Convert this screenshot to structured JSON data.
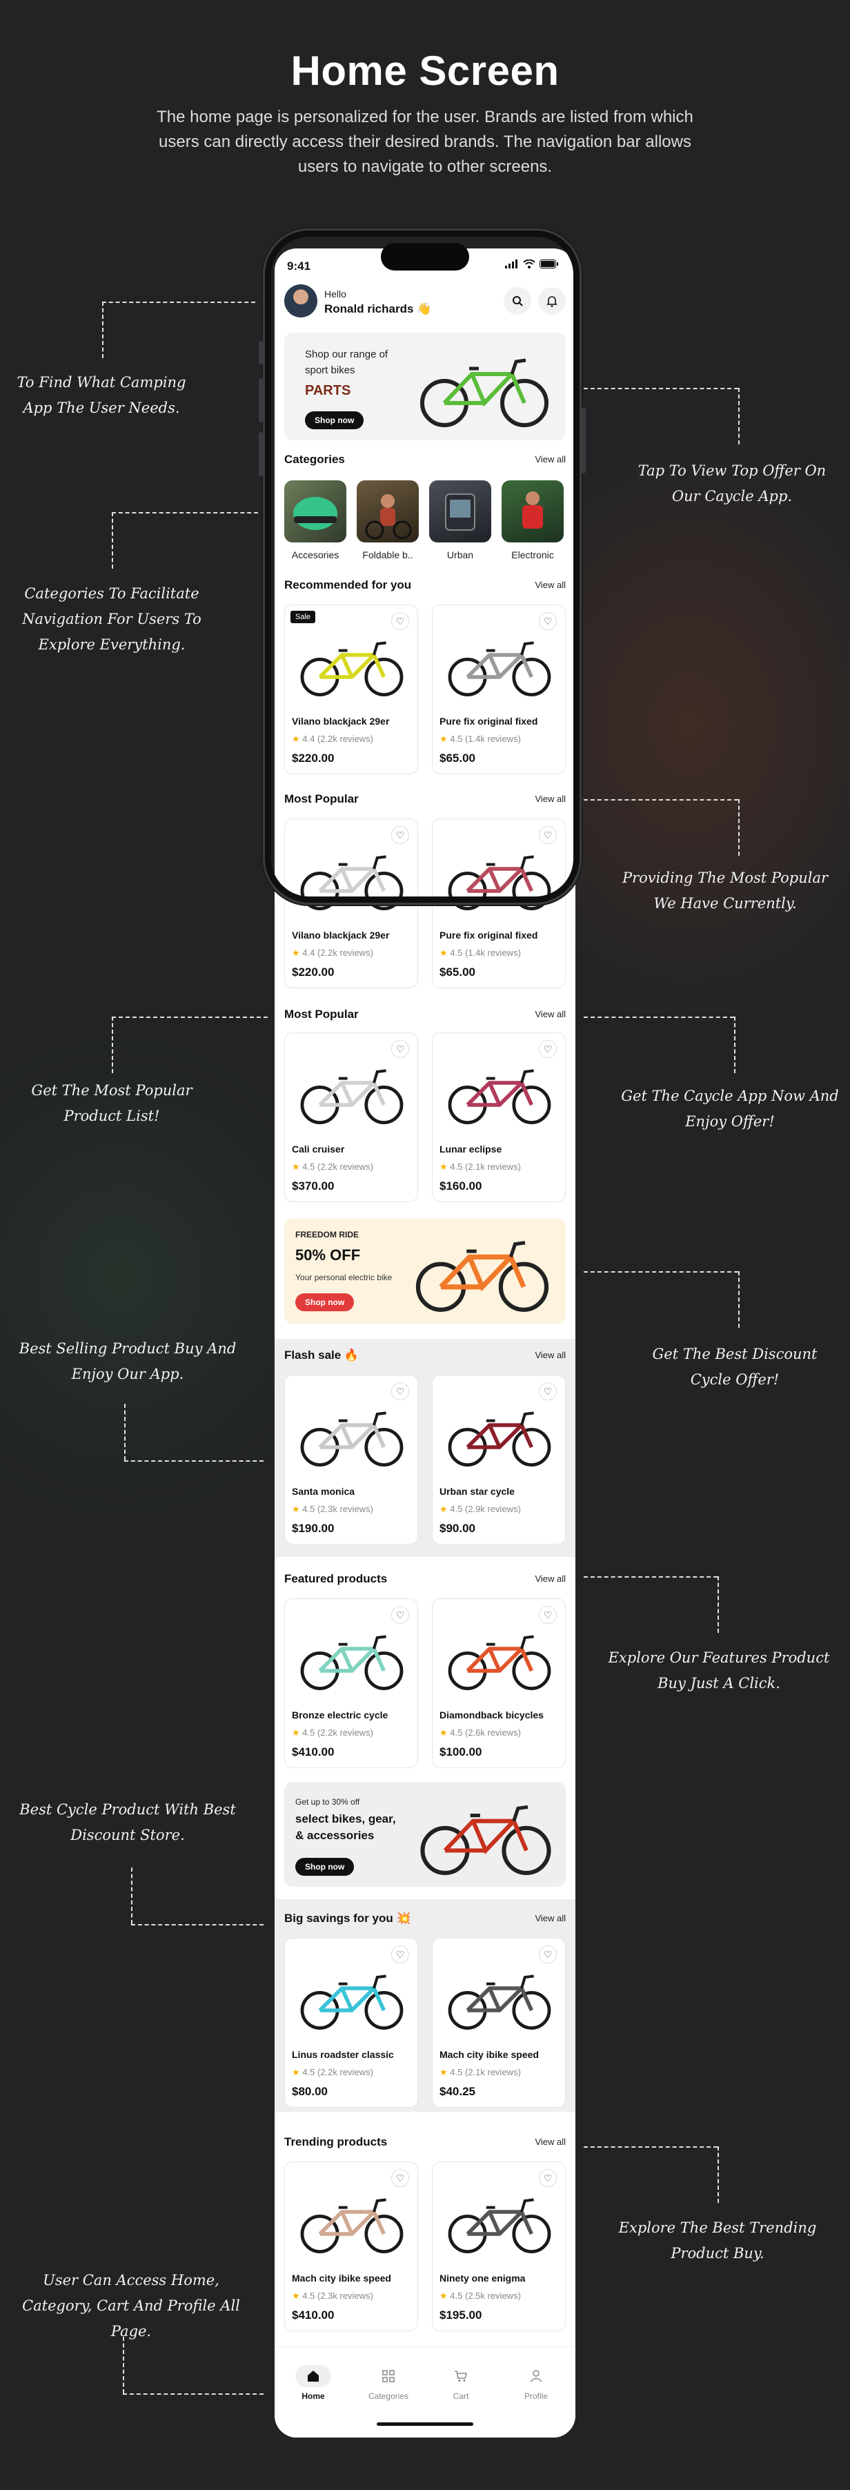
{
  "hero": {
    "title": "Home Screen",
    "description": "The home page is personalized for the user. Brands are listed from which users can directly access their desired brands. The navigation bar allows users to navigate to other screens."
  },
  "annotations": [
    "To Find What Camping App The User Needs.",
    "Tap To View Top Offer On Our Caycle App.",
    "Categories To Facilitate Navigation For Users To Explore Everything.",
    "Providing The Most Popular We Have Currently.",
    "Get The Most Popular Product List!",
    "Get The Caycle App Now And Enjoy Offer!",
    "Best Selling Product Buy And Enjoy Our App.",
    "Get The Best Discount Cycle Offer!",
    "Explore Our Features Product Buy Just A Click.",
    "Best Cycle Product With Best Discount Store.",
    "Explore The Best Trending Product Buy.",
    "User Can Access Home, Category, Cart And Profile All Page."
  ],
  "status_bar": {
    "time": "9:41"
  },
  "user": {
    "greeting": "Hello",
    "name": "Ronald richards 👋"
  },
  "promo1": {
    "text": "Shop our range of sport bikes",
    "subtitle": "PARTS",
    "button": "Shop now"
  },
  "view_all": "View all",
  "sections": {
    "categories": "Categories",
    "recommended": "Recommended for you",
    "most_popular": "Most Popular",
    "flash_sale": "Flash sale 🔥",
    "featured": "Featured products",
    "big_savings": "Big savings for you 💥",
    "trending": "Trending products"
  },
  "categories": [
    {
      "label": "Accesories"
    },
    {
      "label": "Foldable b.."
    },
    {
      "label": "Urban"
    },
    {
      "label": "Electronic"
    }
  ],
  "sale_badge": "Sale",
  "products": {
    "recommended": [
      {
        "name": "Vilano blackjack 29er",
        "rating": "4.4",
        "reviews": "(2.2k reviews)",
        "price": "$220.00",
        "color": "#d8d820"
      },
      {
        "name": "Pure fix original fixed",
        "rating": "4.5",
        "reviews": "(1.4k reviews)",
        "price": "$65.00",
        "color": "#9a9a9a"
      }
    ],
    "popular_a": [
      {
        "name": "Vilano blackjack 29er",
        "rating": "4.4",
        "reviews": "(2.2k reviews)",
        "price": "$220.00",
        "color": "#cfcfcf"
      },
      {
        "name": "Pure fix original fixed",
        "rating": "4.5",
        "reviews": "(1.4k reviews)",
        "price": "$65.00",
        "color": "#b84a5e"
      }
    ],
    "popular_b": [
      {
        "name": "Cali cruiser",
        "rating": "4.5",
        "reviews": "(2.2k reviews)",
        "price": "$370.00",
        "color": "#d0d0d0"
      },
      {
        "name": "Lunar eclipse",
        "rating": "4.5",
        "reviews": "(2.1k reviews)",
        "price": "$160.00",
        "color": "#b03a5a"
      }
    ],
    "flash_sale": [
      {
        "name": "Santa monica",
        "rating": "4.5",
        "reviews": "(2.3k reviews)",
        "price": "$190.00",
        "color": "#c9c9c9"
      },
      {
        "name": "Urban star cycle",
        "rating": "4.5",
        "reviews": "(2.9k reviews)",
        "price": "$90.00",
        "color": "#8a1f2a"
      }
    ],
    "featured": [
      {
        "name": "Bronze electric cycle",
        "rating": "4.5",
        "reviews": "(2.2k reviews)",
        "price": "$410.00",
        "color": "#7fd3c0"
      },
      {
        "name": "Diamondback bicycles",
        "rating": "4.5",
        "reviews": "(2.6k reviews)",
        "price": "$100.00",
        "color": "#e2532a"
      }
    ],
    "big_savings": [
      {
        "name": "Linus roadster classic",
        "rating": "4.5",
        "reviews": "(2.2k reviews)",
        "price": "$80.00",
        "color": "#39c3d6"
      },
      {
        "name": "Mach city ibike speed",
        "rating": "4.5",
        "reviews": "(2.1k reviews)",
        "price": "$40.25",
        "color": "#555555"
      }
    ],
    "trending": [
      {
        "name": "Mach city ibike speed",
        "rating": "4.5",
        "reviews": "(2.3k reviews)",
        "price": "$410.00",
        "color": "#d0a890"
      },
      {
        "name": "Ninety one enigma",
        "rating": "4.5",
        "reviews": "(2.5k reviews)",
        "price": "$195.00",
        "color": "#555555"
      }
    ]
  },
  "promo2": {
    "eyebrow": "FREEDOM RIDE",
    "headline": "50% OFF",
    "text": "Your personal electric bike",
    "button": "Shop now"
  },
  "promo3": {
    "eyebrow": "Get up to 30% off",
    "headline": "select bikes, gear, & accessories",
    "button": "Shop now"
  },
  "nav": [
    {
      "label": "Home",
      "icon": "home-icon"
    },
    {
      "label": "Categories",
      "icon": "grid-icon"
    },
    {
      "label": "Cart",
      "icon": "cart-icon"
    },
    {
      "label": "Profile",
      "icon": "profile-icon"
    }
  ],
  "colors": {
    "background": "#212325",
    "sale_red": "#e23b3b",
    "star": "#f5b301",
    "promo_cream": "#fdf3df"
  }
}
